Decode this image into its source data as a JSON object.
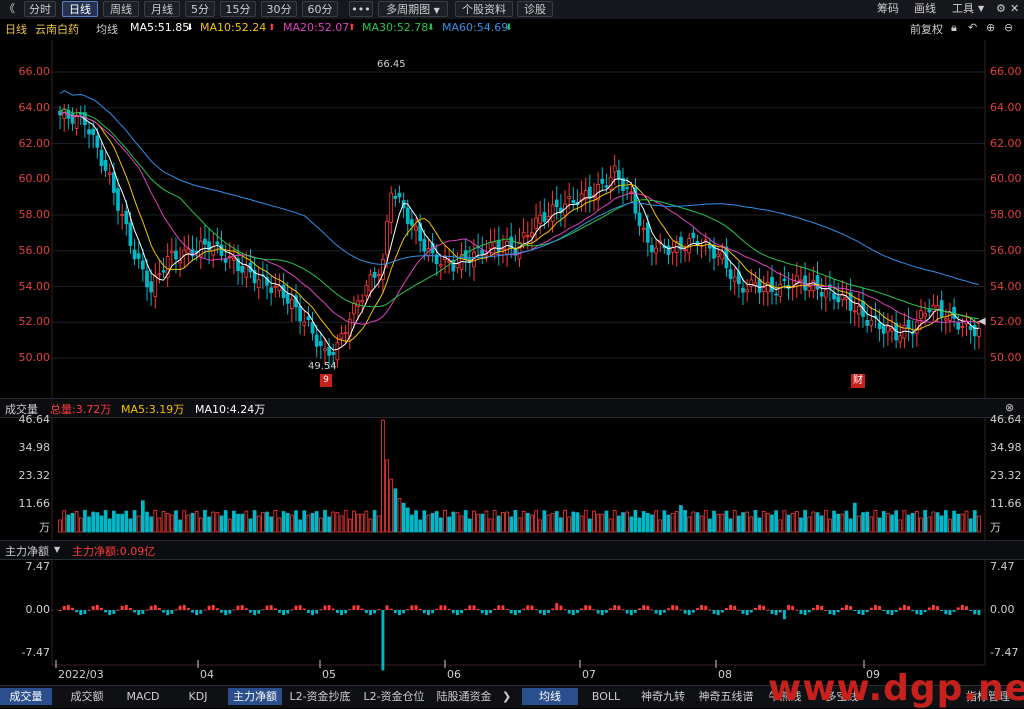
{
  "toolbar": {
    "back_icon": "《",
    "tabs": [
      "分时",
      "日线",
      "周线",
      "月线",
      "5分",
      "15分",
      "30分",
      "60分"
    ],
    "active_tab": "日线",
    "more": "•••",
    "multi_period": "多周期图",
    "stock_info": "个股资料",
    "diagnose": "诊股",
    "right_items": [
      "筹码",
      "画线",
      "工具"
    ],
    "expand_icon": "▼"
  },
  "infobar": {
    "period": "日线",
    "stock_name": "云南白药",
    "ma_label": "均线",
    "ma5": "MA5:51.85",
    "ma10": "MA10:52.24",
    "ma20": "MA20:52.07",
    "ma30": "MA30:52.78",
    "ma60": "MA60:54.69",
    "fq": "前复权"
  },
  "price_axis": [
    "66.00",
    "64.00",
    "62.00",
    "60.00",
    "58.00",
    "56.00",
    "54.00",
    "52.00",
    "50.00"
  ],
  "annotations": {
    "high": "66.45",
    "low": "49.54",
    "badge1": "9",
    "badge2": "财"
  },
  "volume_panel": {
    "title": "成交量",
    "total": "总量:3.72万",
    "ma5": "MA5:3.19万",
    "ma10": "MA10:4.24万",
    "axis": [
      "46.64",
      "34.98",
      "23.32",
      "11.66",
      "万"
    ]
  },
  "flow_panel": {
    "title": "主力净额",
    "value": "主力净额:0.09亿",
    "axis": [
      "7.47",
      "0.00",
      "-7.47"
    ]
  },
  "date_axis": [
    "2022/03",
    "04",
    "05",
    "06",
    "07",
    "08",
    "09"
  ],
  "bottom_tabs_left": [
    "成交量",
    "成交额",
    "MACD",
    "KDJ",
    "主力净额",
    "L2-资金抄底",
    "L2-资金仓位",
    "陆股通资金"
  ],
  "bottom_tabs_right": [
    "均线",
    "BOLL",
    "神奇九转",
    "神奇五线谱",
    "牛熊线",
    "多空线",
    "指标管理"
  ],
  "watermark": "www.dgp.net",
  "colors": {
    "up": "#ff3a3a",
    "down": "#00b8c8",
    "ma5": "#ffffff",
    "ma10": "#f2c200",
    "ma20": "#e040c0",
    "ma30": "#27c44a",
    "ma60": "#2f8fe8"
  }
}
